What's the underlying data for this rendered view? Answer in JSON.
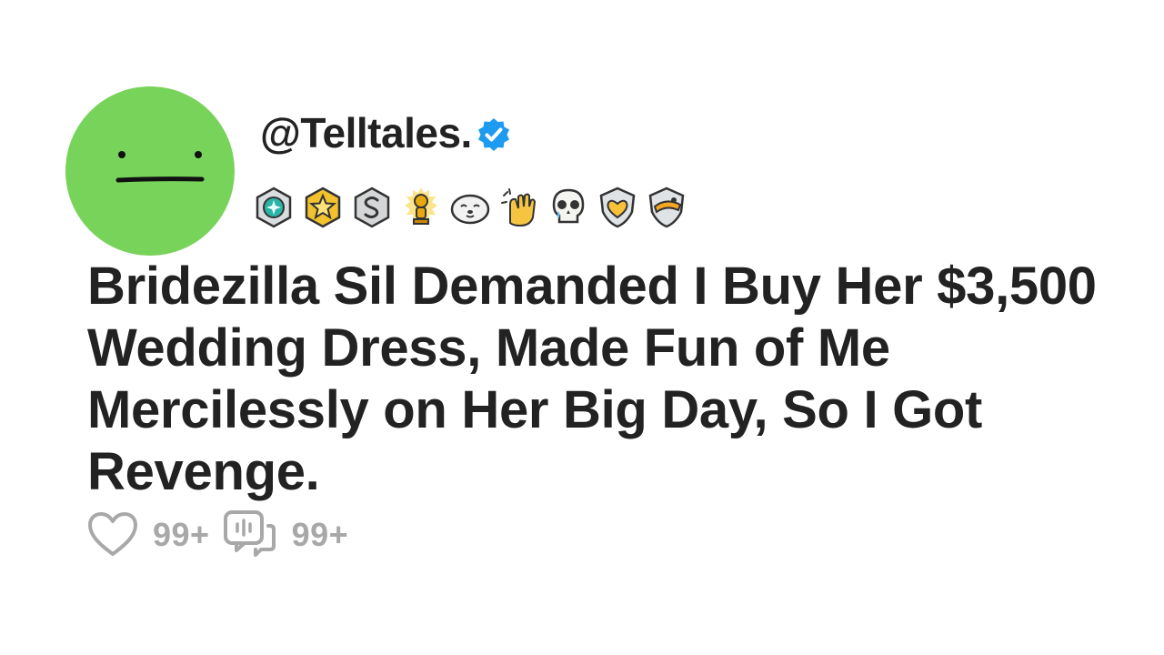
{
  "post": {
    "handle": "@Telltales.",
    "verified": true,
    "headline": "Bridezilla Sil Demanded I Buy Her $3,500 Wedding Dress, Made Fun of Me Mercilessly on Her Big Day, So I Got Revenge.",
    "awards": [
      "platinum-gem-award-icon",
      "gold-star-award-icon",
      "silver-s-award-icon",
      "gold-trophy-snoo-award-icon",
      "seal-award-icon",
      "clapping-hands-award-icon",
      "crying-skull-award-icon",
      "heart-shield-award-icon",
      "shield-kiss-award-icon"
    ]
  },
  "stats": {
    "likes": "99+",
    "comments": "99+"
  },
  "colors": {
    "avatar": "#78d35a",
    "verified": "#1d9bf0",
    "text": "#222222",
    "muted": "#a8a8a8"
  }
}
